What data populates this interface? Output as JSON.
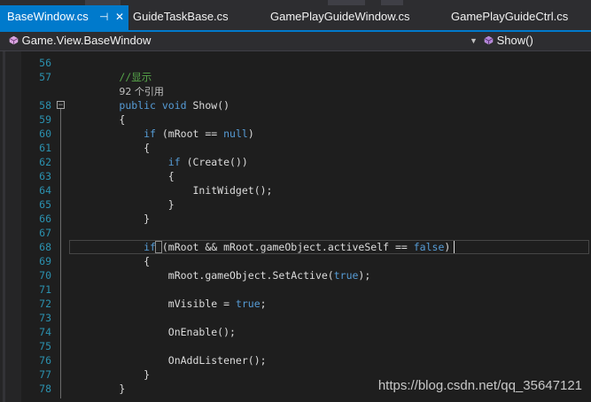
{
  "tabs": [
    {
      "label": "BaseWindow.cs",
      "active": true,
      "pin": "⊣",
      "close": "✕"
    },
    {
      "label": "GuideTaskBase.cs",
      "active": false
    },
    {
      "label": "GamePlayGuideWindow.cs",
      "active": false
    },
    {
      "label": "GamePlayGuideCtrl.cs",
      "active": false
    }
  ],
  "navigation": {
    "class_path": "Game.View.BaseWindow",
    "member": "Show()"
  },
  "code_lines": [
    {
      "num": "56",
      "html": ""
    },
    {
      "num": "57",
      "html": "        <span class='cm'>//显示</span>"
    },
    {
      "num": "",
      "html": "        <span class='ref'>92 个引用</span>"
    },
    {
      "num": "58",
      "html": "        <span class='kw'>public</span> <span class='kw'>void</span> Show()"
    },
    {
      "num": "59",
      "html": "        {"
    },
    {
      "num": "60",
      "html": "            <span class='kw'>if</span> (mRoot == <span class='kw'>null</span>)"
    },
    {
      "num": "61",
      "html": "            {"
    },
    {
      "num": "62",
      "html": "                <span class='kw'>if</span> (Create())"
    },
    {
      "num": "63",
      "html": "                {"
    },
    {
      "num": "64",
      "html": "                    InitWidget();"
    },
    {
      "num": "65",
      "html": "                }"
    },
    {
      "num": "66",
      "html": "            }"
    },
    {
      "num": "67",
      "html": ""
    },
    {
      "num": "68",
      "html": "            <span class='kw'>if</span> (mRoot &amp;&amp; mRoot.gameObject.activeSelf == <span class='kw'>false</span>)"
    },
    {
      "num": "69",
      "html": "            {"
    },
    {
      "num": "70",
      "html": "                mRoot.gameObject.SetActive(<span class='kw'>true</span>);"
    },
    {
      "num": "71",
      "html": ""
    },
    {
      "num": "72",
      "html": "                mVisible = <span class='kw'>true</span>;"
    },
    {
      "num": "73",
      "html": ""
    },
    {
      "num": "74",
      "html": "                OnEnable();"
    },
    {
      "num": "75",
      "html": ""
    },
    {
      "num": "76",
      "html": "                OnAddListener();"
    },
    {
      "num": "77",
      "html": "            }"
    },
    {
      "num": "78",
      "html": "        }"
    }
  ],
  "watermark": "https://blog.csdn.net/qq_35647121",
  "colors": {
    "accent": "#007acc",
    "keyword": "#569cd6",
    "comment": "#57a64a",
    "line_number": "#2b91af",
    "background": "#1e1e1e"
  },
  "icons": {
    "navigation_class": "csharp-class-icon",
    "navigation_member": "method-icon",
    "dropdown": "chevron-down-icon"
  }
}
